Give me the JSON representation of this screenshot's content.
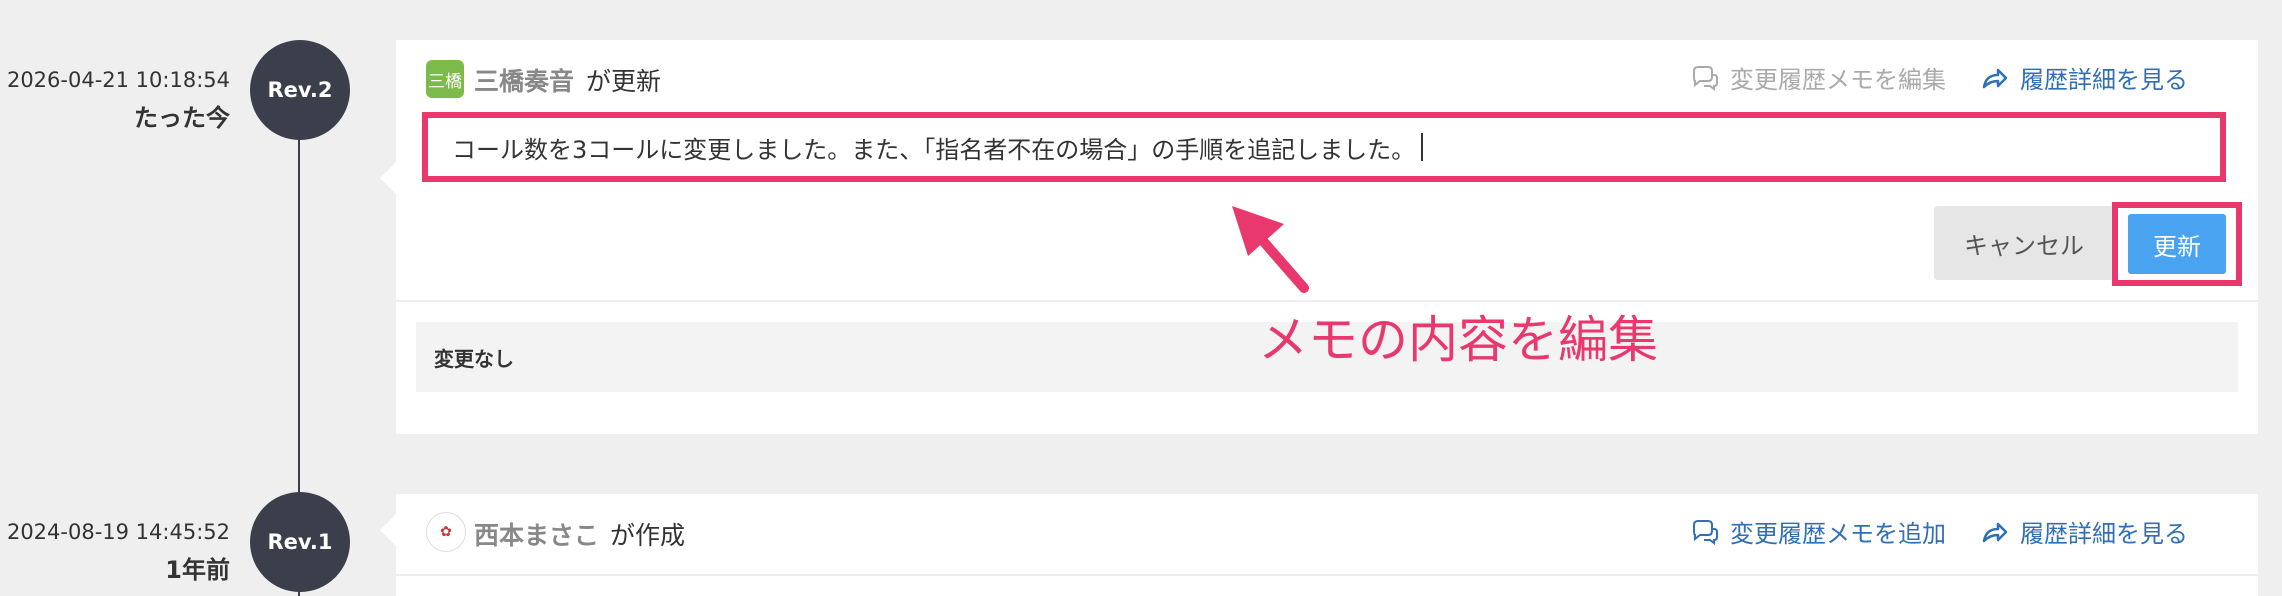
{
  "colors": {
    "annotation": "#e8386d",
    "link": "#2f6fb5",
    "primary_button": "#4aa3f0",
    "timeline": "#3a3f4b"
  },
  "revisions": [
    {
      "date": "2026-04-21 10:18:54",
      "relative": "たった今",
      "rev_label": "Rev.2",
      "avatar_text": "三橋",
      "author": "三橋奏音",
      "action": "が更新",
      "memo_link": "変更履歴メモを編集",
      "memo_icon": "comment-icon",
      "detail_link": "履歴詳細を見る",
      "detail_icon": "share-arrow-icon",
      "memo_value": "コール数を3コールに変更しました。また、「指名者不在の場合」の手順を追記しました。",
      "cancel_label": "キャンセル",
      "save_label": "更新",
      "change_summary": "変更なし"
    },
    {
      "date": "2024-08-19 14:45:52",
      "relative": "1年前",
      "rev_label": "Rev.1",
      "author": "西本まさこ",
      "action": "が作成",
      "memo_link": "変更履歴メモを追加",
      "memo_icon": "comment-icon",
      "detail_link": "履歴詳細を見る",
      "detail_icon": "share-arrow-icon"
    }
  ],
  "annotation": {
    "text": "メモの内容を編集",
    "arrow_icon": "arrow-icon"
  }
}
